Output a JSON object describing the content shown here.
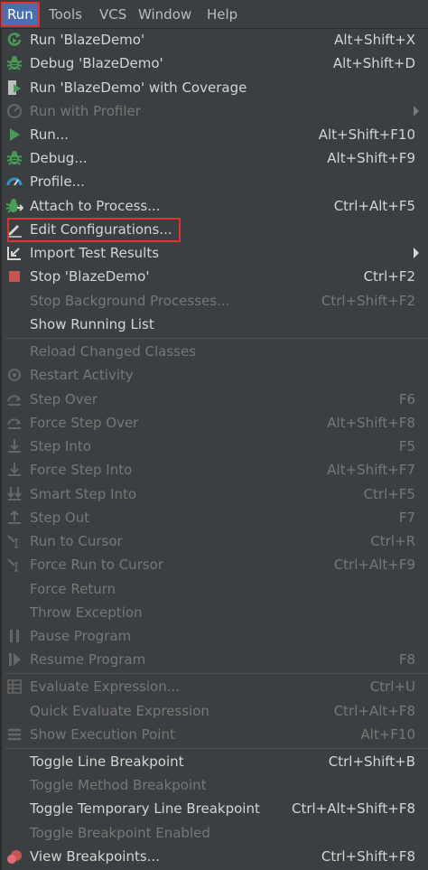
{
  "menubar": {
    "items": [
      {
        "label": "Run",
        "active": true
      },
      {
        "label": "Tools"
      },
      {
        "label": "VCS"
      },
      {
        "label": "Window"
      },
      {
        "label": "Help"
      }
    ]
  },
  "menu": {
    "items": [
      {
        "label": "Run 'BlazeDemo'",
        "shortcut": "Alt+Shift+X",
        "icon": "rerun-icon",
        "enabled": true
      },
      {
        "label": "Debug 'BlazeDemo'",
        "shortcut": "Alt+Shift+D",
        "icon": "debug-bug-icon",
        "enabled": true
      },
      {
        "label": "Run 'BlazeDemo' with Coverage",
        "shortcut": "",
        "icon": "coverage-icon",
        "enabled": true
      },
      {
        "label": "Run with Profiler",
        "shortcut": "",
        "icon": "profiler-icon",
        "enabled": false,
        "submenu": true
      },
      {
        "label": "Run...",
        "shortcut": "Alt+Shift+F10",
        "icon": "run-triangle-icon",
        "enabled": true
      },
      {
        "label": "Debug...",
        "shortcut": "Alt+Shift+F9",
        "icon": "debug-bug-icon",
        "enabled": true
      },
      {
        "label": "Profile...",
        "shortcut": "",
        "icon": "profile-gauge-icon",
        "enabled": true
      },
      {
        "label": "Attach to Process...",
        "shortcut": "Ctrl+Alt+F5",
        "icon": "attach-bug-icon",
        "enabled": true
      },
      {
        "label": "Edit Configurations...",
        "shortcut": "",
        "icon": "edit-pencil-icon",
        "enabled": true,
        "highlighted": true
      },
      {
        "label": "Import Test Results",
        "shortcut": "",
        "icon": "import-arrow-icon",
        "enabled": true,
        "submenu": true
      },
      {
        "label": "Stop 'BlazeDemo'",
        "shortcut": "Ctrl+F2",
        "icon": "stop-square-icon",
        "enabled": true
      },
      {
        "label": "Stop Background Processes...",
        "shortcut": "Ctrl+Shift+F2",
        "icon": "",
        "enabled": false
      },
      {
        "label": "Show Running List",
        "shortcut": "",
        "icon": "",
        "enabled": true
      },
      {
        "label": "Reload Changed Classes",
        "shortcut": "",
        "icon": "",
        "enabled": false
      },
      {
        "label": "Restart Activity",
        "shortcut": "",
        "icon": "restart-icon",
        "enabled": false
      },
      {
        "label": "Step Over",
        "shortcut": "F6",
        "icon": "step-over-icon",
        "enabled": false
      },
      {
        "label": "Force Step Over",
        "shortcut": "Alt+Shift+F8",
        "icon": "force-step-over-icon",
        "enabled": false
      },
      {
        "label": "Step Into",
        "shortcut": "F5",
        "icon": "step-into-icon",
        "enabled": false
      },
      {
        "label": "Force Step Into",
        "shortcut": "Alt+Shift+F7",
        "icon": "force-step-into-icon",
        "enabled": false
      },
      {
        "label": "Smart Step Into",
        "shortcut": "Ctrl+F5",
        "icon": "smart-step-into-icon",
        "enabled": false
      },
      {
        "label": "Step Out",
        "shortcut": "F7",
        "icon": "step-out-icon",
        "enabled": false
      },
      {
        "label": "Run to Cursor",
        "shortcut": "Ctrl+R",
        "icon": "run-to-cursor-icon",
        "enabled": false
      },
      {
        "label": "Force Run to Cursor",
        "shortcut": "Ctrl+Alt+F9",
        "icon": "force-run-to-cursor-icon",
        "enabled": false
      },
      {
        "label": "Force Return",
        "shortcut": "",
        "icon": "",
        "enabled": false
      },
      {
        "label": "Throw Exception",
        "shortcut": "",
        "icon": "",
        "enabled": false
      },
      {
        "label": "Pause Program",
        "shortcut": "",
        "icon": "pause-icon",
        "enabled": false
      },
      {
        "label": "Resume Program",
        "shortcut": "F8",
        "icon": "resume-icon",
        "enabled": false
      },
      {
        "label": "Evaluate Expression...",
        "shortcut": "Ctrl+U",
        "icon": "evaluate-grid-icon",
        "enabled": false
      },
      {
        "label": "Quick Evaluate Expression",
        "shortcut": "Ctrl+Alt+F8",
        "icon": "",
        "enabled": false
      },
      {
        "label": "Show Execution Point",
        "shortcut": "Alt+F10",
        "icon": "execution-point-icon",
        "enabled": false
      },
      {
        "label": "Toggle Line Breakpoint",
        "shortcut": "Ctrl+Shift+B",
        "icon": "",
        "enabled": true
      },
      {
        "label": "Toggle Method Breakpoint",
        "shortcut": "",
        "icon": "",
        "enabled": false
      },
      {
        "label": "Toggle Temporary Line Breakpoint",
        "shortcut": "Ctrl+Alt+Shift+F8",
        "icon": "",
        "enabled": true
      },
      {
        "label": "Toggle Breakpoint Enabled",
        "shortcut": "",
        "icon": "",
        "enabled": false
      },
      {
        "label": "View Breakpoints...",
        "shortcut": "Ctrl+Shift+F8",
        "icon": "breakpoints-icon",
        "enabled": true
      }
    ]
  },
  "colors": {
    "background": "#3c3f41",
    "selected": "#4b6eaf",
    "highlight_border": "#e0312e",
    "enabled_text": "#d4d4d4",
    "disabled_text": "#777777",
    "green": "#499c54",
    "red": "#c75450",
    "blue": "#3592c4"
  }
}
